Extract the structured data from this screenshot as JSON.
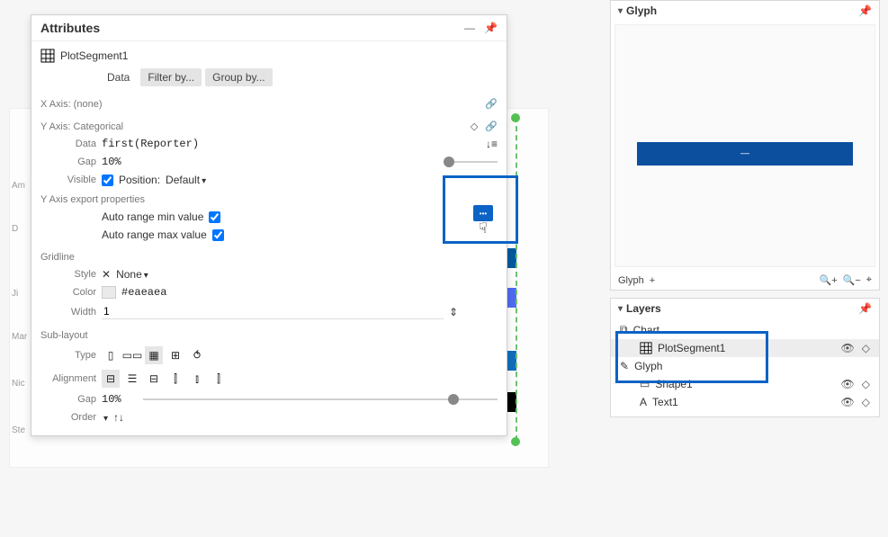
{
  "attributes": {
    "title": "Attributes",
    "object_name": "PlotSegment1",
    "tabs": {
      "data": "Data",
      "filter": "Filter by...",
      "group": "Group by..."
    },
    "xaxis": {
      "label": "X Axis: (none)"
    },
    "yaxis": {
      "label": "Y Axis: Categorical",
      "data_label": "Data",
      "data_value": "first(Reporter)",
      "gap_label": "Gap",
      "gap_value": "10%",
      "visible_label": "Visible",
      "position_label": "Position:",
      "position_value": "Default",
      "export_label": "Y Axis export properties",
      "auto_min": "Auto range min value",
      "auto_max": "Auto range max value"
    },
    "gridline": {
      "label": "Gridline",
      "style_label": "Style",
      "style_value": "None",
      "color_label": "Color",
      "color_value": "#eaeaea",
      "width_label": "Width",
      "width_value": "1"
    },
    "sublayout": {
      "label": "Sub-layout",
      "type_label": "Type",
      "align_label": "Alignment",
      "gap_label": "Gap",
      "gap_value": "10%",
      "order_label": "Order"
    }
  },
  "glyph": {
    "title": "Glyph",
    "footer_label": "Glyph",
    "plus": "+"
  },
  "layers": {
    "title": "Layers",
    "chart": "Chart",
    "plot_segment": "PlotSegment1",
    "glyph": "Glyph",
    "shape": "Shape1",
    "text": "Text1"
  },
  "canvas_labels": [
    "Am",
    "D",
    "Ji",
    "Mar",
    "Nic",
    "Ste"
  ]
}
